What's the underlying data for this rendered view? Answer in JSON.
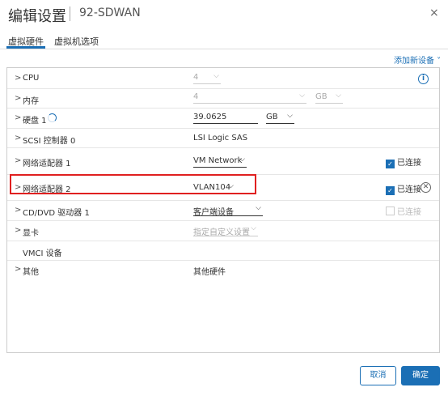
{
  "dialog": {
    "title": "编辑设置",
    "subtitle": "92-SDWAN",
    "close_label": "×"
  },
  "tabs": [
    {
      "label": "虚拟硬件"
    },
    {
      "label": "虚拟机选项"
    }
  ],
  "add_device": "添加新设备 ˅",
  "rows": {
    "cpu": {
      "label": "CPU",
      "value": "4"
    },
    "memory": {
      "label": "内存",
      "value": "4",
      "unit": "GB"
    },
    "disk": {
      "label": "硬盘 1",
      "value": "39.0625",
      "unit": "GB"
    },
    "scsi": {
      "label": "SCSI 控制器 0",
      "value": "LSI Logic SAS"
    },
    "nic1": {
      "label": "网络适配器 1",
      "value": "VM Network",
      "connected_label": "已连接"
    },
    "nic2": {
      "label": "网络适配器 2",
      "value": "VLAN104",
      "connected_label": "已连接"
    },
    "cdrom": {
      "label": "CD/DVD 驱动器 1",
      "value": "客户端设备",
      "connected_label": "已连接"
    },
    "video": {
      "label": "显卡",
      "value": "指定自定义设置"
    },
    "vmci": {
      "label": "VMCI 设备"
    },
    "other": {
      "label": "其他",
      "value": "其他硬件"
    }
  },
  "buttons": {
    "cancel": "取消",
    "ok": "确定"
  },
  "colors": {
    "accent": "#1b6fb5",
    "highlight": "#e02020"
  }
}
